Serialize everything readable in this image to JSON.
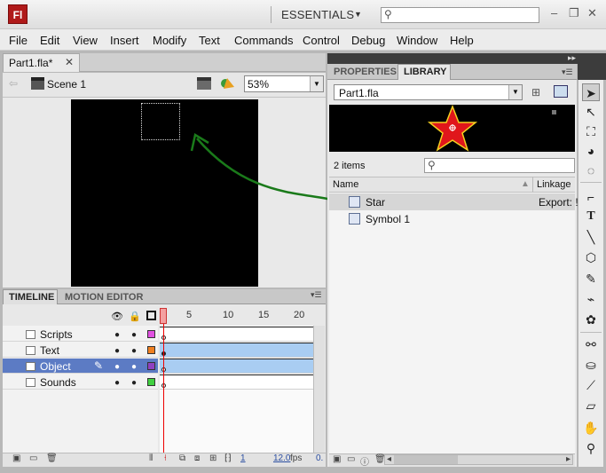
{
  "app": {
    "logo": "Fl",
    "workspace": "ESSENTIALS",
    "search_placeholder": "",
    "window_controls": [
      "–",
      "❐",
      "✕"
    ]
  },
  "menu": [
    "File",
    "Edit",
    "View",
    "Insert",
    "Modify",
    "Text",
    "Commands",
    "Control",
    "Debug",
    "Window",
    "Help"
  ],
  "document": {
    "tab_label": "Part1.fla*",
    "tab_close": "✕",
    "scene": "Scene 1",
    "zoom": "53%",
    "stage_color": "#000000"
  },
  "timeline": {
    "tabs": [
      "TIMELINE",
      "MOTION EDITOR"
    ],
    "frame_numbers": [
      "1",
      "5",
      "10",
      "15",
      "20"
    ],
    "layers": [
      {
        "name": "Scripts",
        "color": "#e050e0",
        "selected": false
      },
      {
        "name": "Text",
        "color": "#f08020",
        "selected": false
      },
      {
        "name": "Object",
        "color": "#9040c0",
        "selected": true
      },
      {
        "name": "Sounds",
        "color": "#40d040",
        "selected": false
      }
    ],
    "current_frame": "1",
    "frame_rate": "12.0",
    "fps_label": "fps",
    "elapsed": "0."
  },
  "library": {
    "tabs": [
      "PROPERTIES",
      "LIBRARY"
    ],
    "document": "Part1.fla",
    "item_count": "2 items",
    "columns": {
      "name": "Name",
      "linkage": "Linkage"
    },
    "items": [
      {
        "name": "Star",
        "linkage": "Export: !"
      },
      {
        "name": "Symbol 1",
        "linkage": ""
      }
    ]
  },
  "colors": {
    "star_fill": "#e0161b",
    "star_stroke": "#f4d020",
    "arrow": "#1a7a1a",
    "selected_layer": "#5c7bc4"
  }
}
